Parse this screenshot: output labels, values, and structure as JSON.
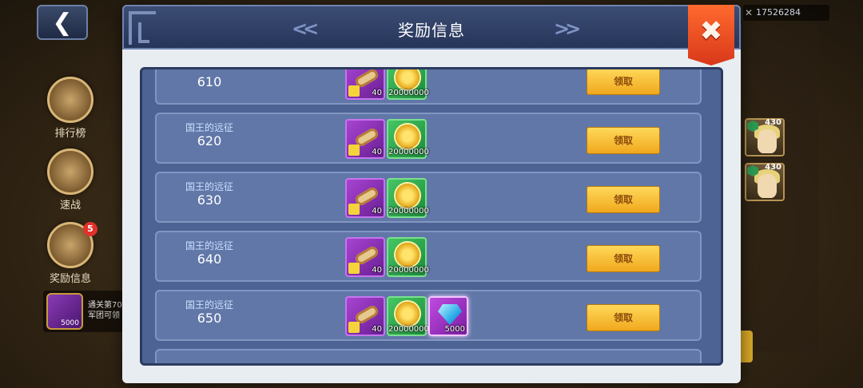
{
  "background": {
    "back_icon": "chevron-left-icon",
    "player_id": "17526284",
    "side_menu": [
      {
        "label": "排行榜",
        "icon": "trophy-icon"
      },
      {
        "label": "速战",
        "icon": "shield-icon"
      },
      {
        "label": "奖励信息",
        "icon": "chest-icon",
        "badge": "5"
      }
    ],
    "side_reward": {
      "qty": "5000",
      "text_line1": "通关第70",
      "text_line2": "军团可领"
    },
    "heroes": [
      {
        "level": "430"
      },
      {
        "level": "430"
      }
    ]
  },
  "modal": {
    "title": "奖励信息",
    "nav_left_icon": "double-chevron-left-icon",
    "nav_right_icon": "double-chevron-right-icon",
    "close_icon": "close-icon",
    "rows": [
      {
        "label": "",
        "number": "610",
        "items": [
          {
            "type": "scroll",
            "qty": "40"
          },
          {
            "type": "coin",
            "qty": "20000000"
          }
        ],
        "button": "领取"
      },
      {
        "label": "国王的远征",
        "number": "620",
        "items": [
          {
            "type": "scroll",
            "qty": "40"
          },
          {
            "type": "coin",
            "qty": "20000000"
          }
        ],
        "button": "领取"
      },
      {
        "label": "国王的远征",
        "number": "630",
        "items": [
          {
            "type": "scroll",
            "qty": "40"
          },
          {
            "type": "coin",
            "qty": "20000000"
          }
        ],
        "button": "领取"
      },
      {
        "label": "国王的远征",
        "number": "640",
        "items": [
          {
            "type": "scroll",
            "qty": "40"
          },
          {
            "type": "coin",
            "qty": "20000000"
          }
        ],
        "button": "领取"
      },
      {
        "label": "国王的远征",
        "number": "650",
        "items": [
          {
            "type": "scroll",
            "qty": "40"
          },
          {
            "type": "coin",
            "qty": "20000000"
          },
          {
            "type": "gem",
            "qty": "5000"
          }
        ],
        "button": "领取"
      }
    ]
  },
  "colors": {
    "accent": "#f0a81d",
    "close": "#d8381a",
    "panel": "#4c6394"
  }
}
